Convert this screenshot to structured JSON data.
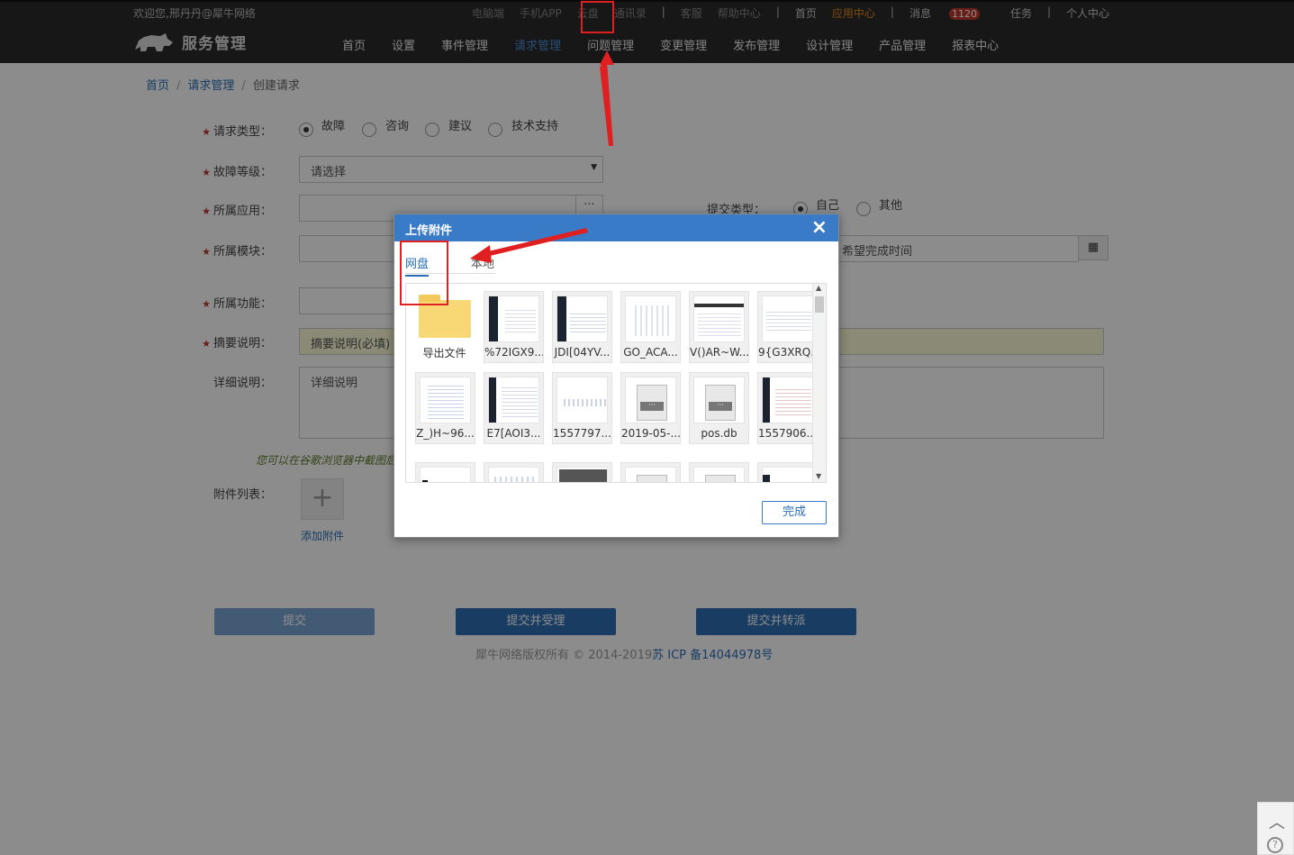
{
  "topbar": {
    "welcome": "欢迎您,邢丹丹@犀牛网络",
    "links": [
      "电脑端",
      "手机APP",
      "云盘",
      "通讯录",
      "客服",
      "帮助中心",
      "首页",
      "应用中心",
      "消息",
      "任务",
      "个人中心"
    ],
    "message_count": "1120"
  },
  "nav": {
    "brand": "服务管理",
    "menu": [
      "首页",
      "设置",
      "事件管理",
      "请求管理",
      "问题管理",
      "变更管理",
      "发布管理",
      "设计管理",
      "产品管理",
      "报表中心"
    ]
  },
  "breadcrumb": {
    "home": "首页",
    "section": "请求管理",
    "current": "创建请求"
  },
  "form": {
    "request_type_label": "请求类型：",
    "request_types": [
      "故障",
      "咨询",
      "建议",
      "技术支持"
    ],
    "fault_level_label": "故障等级：",
    "fault_level_value": "请选择",
    "app_label": "所属应用：",
    "submit_type_label": "提交类型：",
    "submit_types": [
      "自己",
      "其他"
    ],
    "module_label": "所属模块：",
    "expected_time_placeholder": "希望完成时间",
    "function_label": "所属功能：",
    "summary_label": "摘要说明：",
    "summary_placeholder": "摘要说明(必填)",
    "detail_label": "详细说明：",
    "detail_placeholder": "详细说明",
    "hint": "您可以在谷歌浏览器中截图后",
    "attachments_label": "附件列表：",
    "add_attachment": "添加附件"
  },
  "buttons": {
    "submit": "提交",
    "submit_accept": "提交并受理",
    "submit_transfer": "提交并转派"
  },
  "footer": {
    "copyright": "犀牛网络版权所有 © 2014-2019",
    "icp": "苏 ICP 备14044978号"
  },
  "modal": {
    "title": "上传附件",
    "tabs": [
      "网盘",
      "本地"
    ],
    "files": [
      {
        "name": "导出文件",
        "kind": "folder"
      },
      {
        "name": "%72IGX9...",
        "kind": "image-dark"
      },
      {
        "name": "JDI[04YV...",
        "kind": "image-dark"
      },
      {
        "name": "GO_ACA...",
        "kind": "image-light"
      },
      {
        "name": "V()AR~W...",
        "kind": "image-light"
      },
      {
        "name": "9{G3XRQ...",
        "kind": "image-light"
      },
      {
        "name": "Z_)H~96...",
        "kind": "image-light"
      },
      {
        "name": "E7[AOI3...",
        "kind": "image-dark"
      },
      {
        "name": "1557797...",
        "kind": "image-light"
      },
      {
        "name": "2019-05-...",
        "kind": "file"
      },
      {
        "name": "pos.db",
        "kind": "file"
      },
      {
        "name": "1557906...",
        "kind": "image-dark"
      }
    ],
    "done": "完成"
  }
}
